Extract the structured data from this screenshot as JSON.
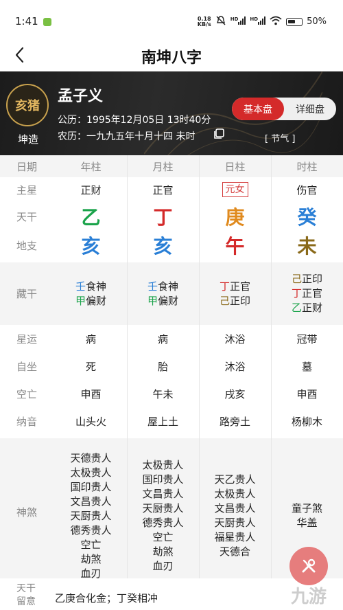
{
  "status_bar": {
    "time": "1:41",
    "speed_value": "0.18",
    "speed_unit": "KB/s",
    "hd1": "HD",
    "hd2": "HD",
    "battery": "50%"
  },
  "header": {
    "title": "南坤八字"
  },
  "profile": {
    "zodiac": "亥猪",
    "gender_label": "坤造",
    "name": "孟子义",
    "solar_label": "公历：",
    "solar": "1995年12月05日 13时40分",
    "lunar_label": "农历：",
    "lunar": "一九九五年十月十四 未时",
    "basic_btn": "基本盘",
    "detail_btn": "详细盘",
    "jieqi": "[ 节气 ]"
  },
  "colors": {
    "wood": "#1aa34a",
    "fire": "#d42a2a",
    "earth": "#8a6a1a",
    "metal": "#e08a1e",
    "water": "#2a7fd6",
    "shensha": "#c89a3c",
    "accent": "#d42a2a"
  },
  "chart": {
    "columns": [
      "年柱",
      "月柱",
      "日柱",
      "时柱"
    ],
    "row_labels": {
      "date": "日期",
      "zhuxing": "主星",
      "tiangan": "天干",
      "dizhi": "地支",
      "canggan": "藏干",
      "xingyun": "星运",
      "zizuo": "自坐",
      "kongwang": "空亡",
      "nayin": "纳音",
      "shensha": "神煞"
    },
    "zhuxing": [
      "正财",
      "正官",
      "元女",
      "伤官"
    ],
    "tiangan": [
      "乙",
      "丁",
      "庚",
      "癸"
    ],
    "dizhi": [
      "亥",
      "亥",
      "午",
      "未"
    ],
    "canggan": [
      [
        {
          "g": "壬",
          "s": "食神"
        },
        {
          "g": "甲",
          "s": "偏财"
        }
      ],
      [
        {
          "g": "壬",
          "s": "食神"
        },
        {
          "g": "甲",
          "s": "偏财"
        }
      ],
      [
        {
          "g": "丁",
          "s": "正官"
        },
        {
          "g": "己",
          "s": "正印"
        }
      ],
      [
        {
          "g": "己",
          "s": "正印"
        },
        {
          "g": "丁",
          "s": "正官"
        },
        {
          "g": "乙",
          "s": "正财"
        }
      ]
    ],
    "xingyun": [
      "病",
      "病",
      "沐浴",
      "冠带"
    ],
    "zizuo": [
      "死",
      "胎",
      "沐浴",
      "墓"
    ],
    "kongwang": [
      "申酉",
      "午未",
      "戌亥",
      "申酉"
    ],
    "nayin": [
      "山头火",
      "屋上土",
      "路旁土",
      "杨柳木"
    ],
    "shensha": [
      [
        "天德贵人",
        "太极贵人",
        "国印贵人",
        "文昌贵人",
        "天厨贵人",
        "德秀贵人",
        "空亡",
        "劫煞",
        "血刃"
      ],
      [
        "太极贵人",
        "国印贵人",
        "文昌贵人",
        "天厨贵人",
        "德秀贵人",
        "空亡",
        "劫煞",
        "血刃"
      ],
      [
        "天乙贵人",
        "太极贵人",
        "文昌贵人",
        "天厨贵人",
        "福星贵人",
        "天德合"
      ],
      [
        "童子煞",
        "华盖"
      ]
    ]
  },
  "bottom": {
    "label": "天干留意",
    "value": "乙庚合化金；丁癸相冲"
  },
  "watermark": "九游"
}
